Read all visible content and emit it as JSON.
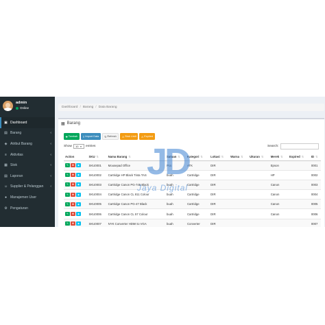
{
  "user": {
    "name": "admin",
    "status": "Online"
  },
  "sidebar": {
    "items": [
      {
        "label": "Dashboard",
        "icon": "dashboard-icon",
        "glyph": "▣",
        "caret": ""
      },
      {
        "label": "Barang",
        "icon": "box-icon",
        "glyph": "▤",
        "caret": "‹"
      },
      {
        "label": "Atribut Barang",
        "icon": "tag-icon",
        "glyph": "◈",
        "caret": "‹"
      },
      {
        "label": "Aktivitas",
        "icon": "activity-icon",
        "glyph": "≡",
        "caret": "‹"
      },
      {
        "label": "Stok",
        "icon": "stock-icon",
        "glyph": "▦",
        "caret": "‹"
      },
      {
        "label": "Laporan",
        "icon": "report-icon",
        "glyph": "▤",
        "caret": "‹"
      },
      {
        "label": "Supplier & Pelanggan",
        "icon": "users-icon",
        "glyph": "☺",
        "caret": "‹"
      },
      {
        "label": "Manajemen User",
        "icon": "user-icon",
        "glyph": "●",
        "caret": ""
      },
      {
        "label": "Pengaturan",
        "icon": "gear-icon",
        "glyph": "⚙",
        "caret": ""
      }
    ]
  },
  "breadcrumb": {
    "items": [
      "Dashboard",
      "Barang",
      "Data Barang"
    ],
    "separator": "/"
  },
  "box": {
    "title": "Barang"
  },
  "toolbar": {
    "tambah": "Tambah",
    "import": "Import Data",
    "refresh": "Refresh",
    "stok_limit": "Stok Limit",
    "expired": "Expired"
  },
  "table_controls": {
    "show_label": "Show",
    "show_value": "10",
    "entries_label": "entries",
    "search_label": "Search:"
  },
  "table": {
    "headers": [
      "Action",
      "SKU",
      "Nama Barang",
      "Satuan",
      "Kategori",
      "Lokasi",
      "Warna",
      "Ukuran",
      "Merek",
      "Expired",
      "ID"
    ],
    "rows": [
      [
        "SKU0001",
        "Mousepad Office",
        "Pcs",
        "ATK",
        "DIR",
        "",
        "",
        "Epson",
        "",
        "0001"
      ],
      [
        "SKU0002",
        "Cartridge HP Black Tinta TAS",
        "buah",
        "Cartridge",
        "DIR",
        "",
        "",
        "HP",
        "",
        "0002"
      ],
      [
        "SKU0003",
        "Cartridge Canon PG-745 Black",
        "buah",
        "Cartridge",
        "DIR",
        "",
        "",
        "Canon",
        "",
        "0003"
      ],
      [
        "SKU0004",
        "Cartridge Canon CL 811 Colour",
        "buah",
        "Cartridge",
        "DIR",
        "",
        "",
        "Canon",
        "",
        "0004"
      ],
      [
        "SKU0005",
        "Cartridge Canon PG-47 Black",
        "buah",
        "Cartridge",
        "DIR",
        "",
        "",
        "Canon",
        "",
        "0005"
      ],
      [
        "SKU0006",
        "Cartridge Canon CL 57 Colour",
        "buah",
        "Cartridge",
        "DIR",
        "",
        "",
        "Canon",
        "",
        "0006"
      ],
      [
        "SKU0007",
        "NYK Converter HDMI to VGA",
        "buah",
        "Converter",
        "DIR",
        "",
        "",
        "",
        "",
        "0007"
      ]
    ]
  },
  "watermark": {
    "main": "JD",
    "sub": "Jaya Digital"
  }
}
